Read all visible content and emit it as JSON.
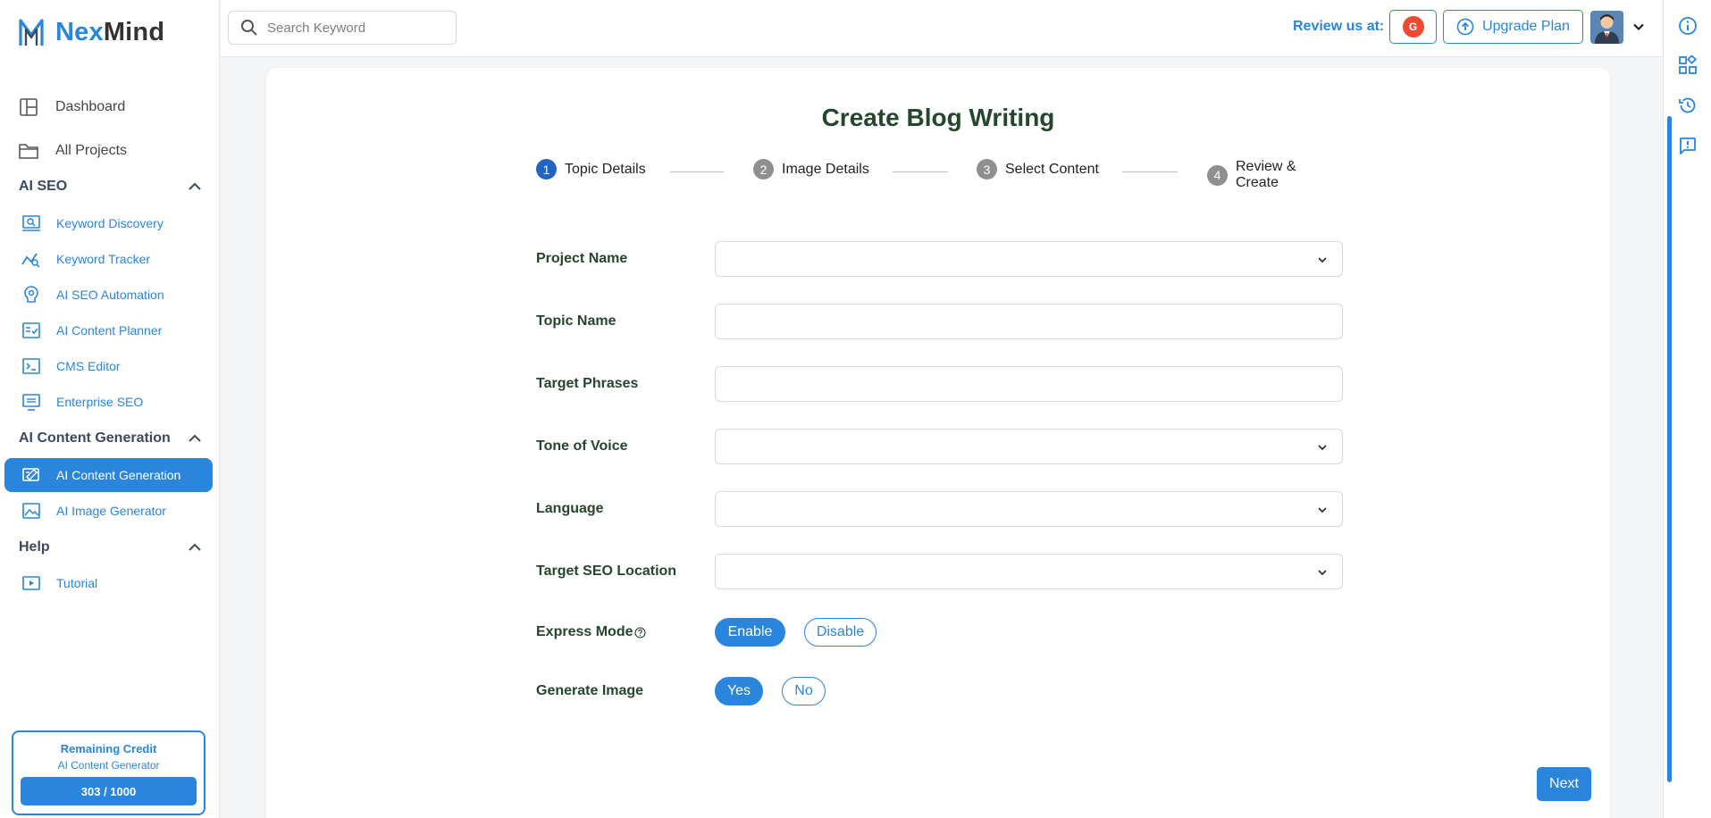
{
  "brand": {
    "name_part1": "Nex",
    "name_part2": "Mind",
    "color": "#2a86dd"
  },
  "sidebar": {
    "top_items": [
      {
        "label": "Dashboard",
        "icon": "dashboard-icon"
      },
      {
        "label": "All Projects",
        "icon": "folder-icon"
      }
    ],
    "sections": [
      {
        "title": "AI SEO",
        "items": [
          {
            "label": "Keyword Discovery",
            "icon": "keyword-discovery-icon"
          },
          {
            "label": "Keyword Tracker",
            "icon": "keyword-tracker-icon"
          },
          {
            "label": "AI SEO Automation",
            "icon": "seo-automation-icon"
          },
          {
            "label": "AI Content Planner",
            "icon": "content-planner-icon"
          },
          {
            "label": "CMS Editor",
            "icon": "cms-editor-icon"
          },
          {
            "label": "Enterprise SEO",
            "icon": "enterprise-seo-icon"
          }
        ]
      },
      {
        "title": "AI Content Generation",
        "items": [
          {
            "label": "AI Content Generation",
            "icon": "content-generation-icon",
            "active": true
          },
          {
            "label": "AI Image Generator",
            "icon": "image-generator-icon"
          }
        ]
      },
      {
        "title": "Help",
        "items": [
          {
            "label": "Tutorial",
            "icon": "tutorial-icon"
          }
        ]
      }
    ],
    "credit": {
      "title": "Remaining Credit",
      "subtitle": "AI Content Generator",
      "value": "303 / 1000"
    }
  },
  "topbar": {
    "search_placeholder": "Search Keyword",
    "review_label": "Review us at:",
    "g2_label": "G",
    "upgrade_label": "Upgrade Plan"
  },
  "page": {
    "title": "Create Blog Writing",
    "steps": [
      {
        "num": "1",
        "label": "Topic Details",
        "active": true
      },
      {
        "num": "2",
        "label": "Image Details"
      },
      {
        "num": "3",
        "label": "Select Content"
      },
      {
        "num": "4",
        "label": "Review & Create"
      }
    ],
    "fields": {
      "project_name": {
        "label": "Project Name",
        "value": ""
      },
      "topic_name": {
        "label": "Topic Name",
        "value": ""
      },
      "target_phrases": {
        "label": "Target Phrases",
        "value": ""
      },
      "tone_of_voice": {
        "label": "Tone of Voice",
        "value": ""
      },
      "language": {
        "label": "Language",
        "value": ""
      },
      "target_seo_location": {
        "label": "Target SEO Location",
        "value": ""
      }
    },
    "express_mode": {
      "label": "Express Mode",
      "enable": "Enable",
      "disable": "Disable",
      "selected": "Enable"
    },
    "generate_image": {
      "label": "Generate Image",
      "yes": "Yes",
      "no": "No",
      "selected": "Yes"
    },
    "next_label": "Next"
  }
}
